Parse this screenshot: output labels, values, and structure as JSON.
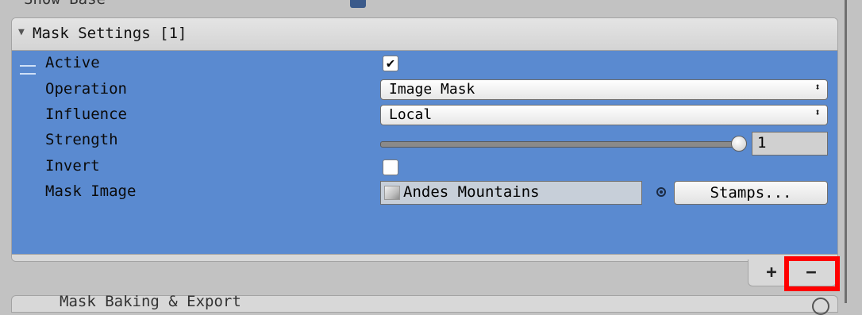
{
  "prev_section": {
    "label": "Show Base"
  },
  "mask_panel": {
    "title": "Mask Settings [1]",
    "fields": {
      "active": {
        "label": "Active",
        "checked": true,
        "check_glyph": "✔"
      },
      "operation": {
        "label": "Operation",
        "value": "Image Mask"
      },
      "influence": {
        "label": "Influence",
        "value": "Local"
      },
      "strength": {
        "label": "Strength",
        "value": "1",
        "slider_fraction": 1.0
      },
      "invert": {
        "label": "Invert",
        "checked": false,
        "check_glyph": ""
      },
      "mask_image": {
        "label": "Mask Image",
        "value": "Andes Mountains",
        "button_label": "Stamps..."
      }
    }
  },
  "list_controls": {
    "add_label": "+",
    "remove_label": "−"
  },
  "next_section": {
    "label": "Mask Baking & Export"
  },
  "icons": {
    "foldout": "triangle-down-icon",
    "drag": "drag-handle-icon",
    "dropdown": "dropdown-arrows-icon",
    "object_picker": "object-picker-icon",
    "help": "help-icon"
  },
  "colors": {
    "selection_blue": "#5a8ad0",
    "panel_bg": "#d8d8d8",
    "highlight_red": "#ff0000"
  }
}
